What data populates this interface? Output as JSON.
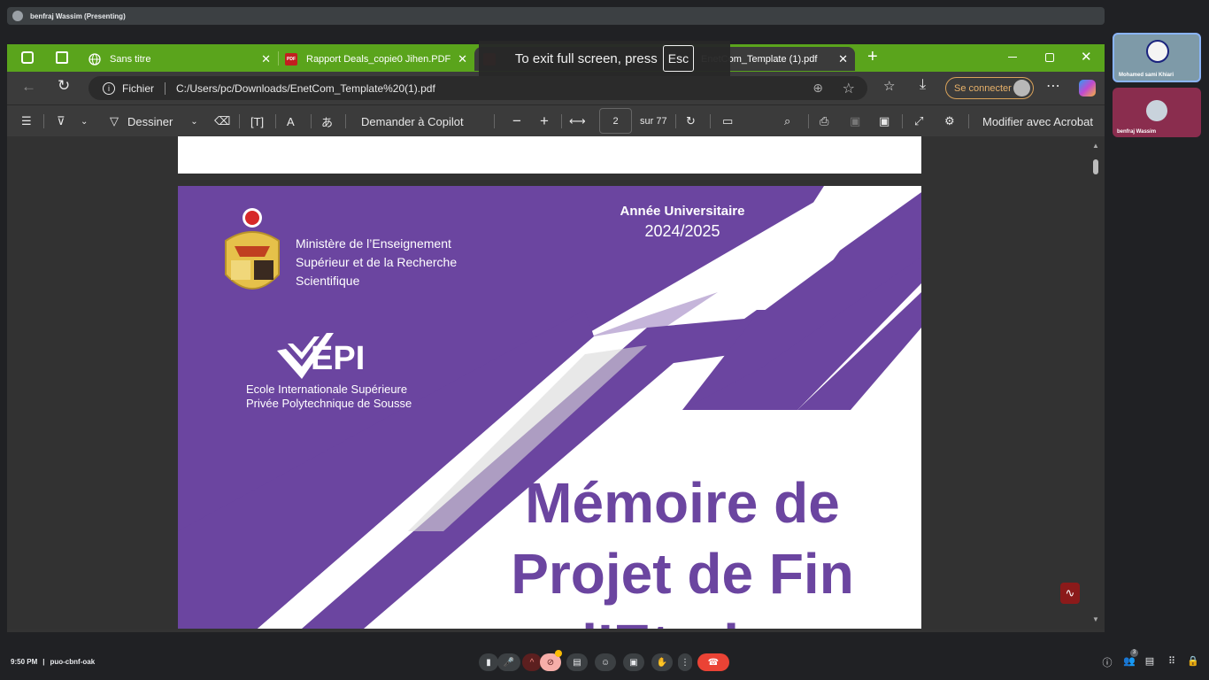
{
  "meet": {
    "presenter_label": "benfraj Wassim (Presenting)",
    "time": "9:50 PM",
    "separator": "|",
    "meeting_code": "puo-cbnf-oak",
    "participants_count": "3",
    "participants": [
      {
        "name": "Mohamed sami Khiari"
      },
      {
        "name": "benfraj Wassim"
      }
    ]
  },
  "browser": {
    "tabs": [
      {
        "title": "Sans titre"
      },
      {
        "title": "Rapport Deals_copie0 Jihen.PDF"
      },
      {
        "title": "EnetCom_Template (1).pdf"
      }
    ],
    "url_scheme": "Fichier",
    "url": "C:/Users/pc/Downloads/EnetCom_Template%20(1).pdf",
    "signin_label": "Se connecter",
    "fullscreen_toast": "To exit full screen, press",
    "fullscreen_key": "Esc"
  },
  "pdf_toolbar": {
    "draw_label": "Dessiner",
    "copilot_label": "Demander à Copilot",
    "page_value": "2",
    "page_total": "sur 77",
    "acrobat_label": "Modifier avec Acrobat"
  },
  "document": {
    "year_title": "Année Universitaire",
    "year": "2024/2025",
    "ministry_line1": "Ministère de l’Enseignement",
    "ministry_line2": "Supérieur et de la Recherche",
    "ministry_line3": "Scientifique",
    "logo_text": "EPI",
    "school_line1": "Ecole Internationale Supérieure",
    "school_line2": "Privée Polytechnique de Sousse",
    "title_line1": "Mémoire de",
    "title_line2": "Projet de Fin",
    "title_line3": "d’Etudes"
  },
  "colors": {
    "tabbar": "#5aa41c",
    "purple": "#6b45a0",
    "end_call": "#ea4335"
  }
}
